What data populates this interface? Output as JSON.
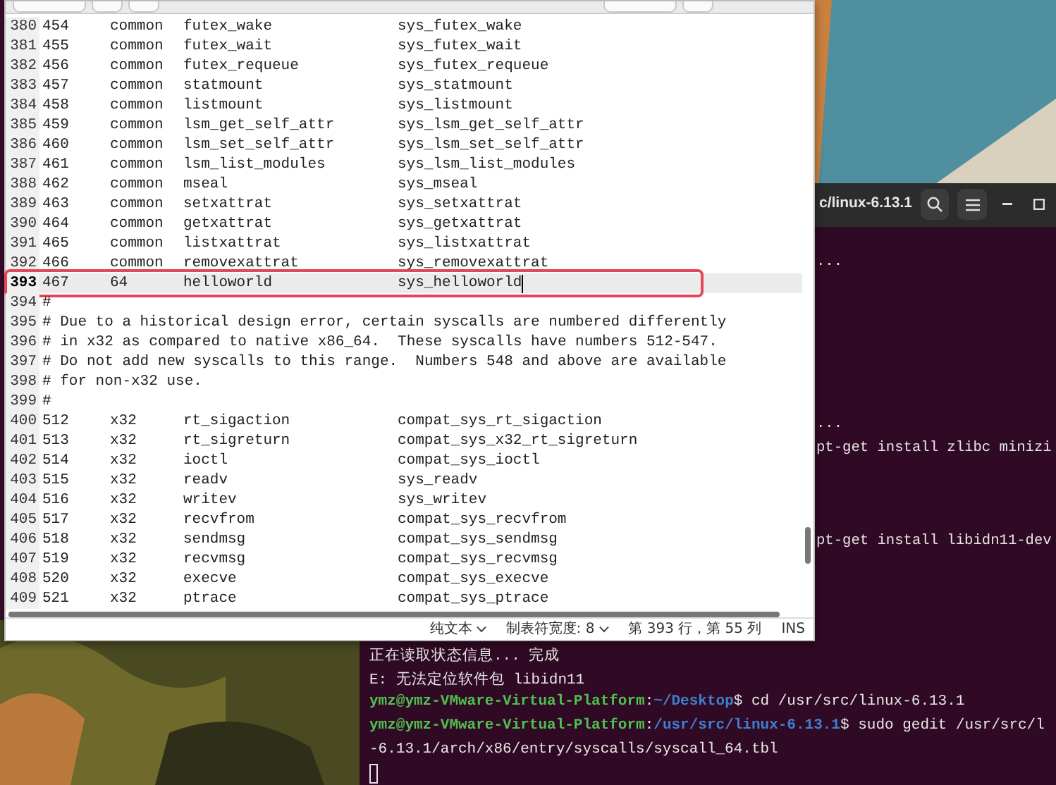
{
  "editor": {
    "lines": [
      {
        "number": "380",
        "kind": "entry",
        "cells": [
          "454",
          "common",
          "futex_wake",
          "sys_futex_wake"
        ],
        "current": false,
        "marked": false
      },
      {
        "number": "381",
        "kind": "entry",
        "cells": [
          "455",
          "common",
          "futex_wait",
          "sys_futex_wait"
        ],
        "current": false,
        "marked": false
      },
      {
        "number": "382",
        "kind": "entry",
        "cells": [
          "456",
          "common",
          "futex_requeue",
          "sys_futex_requeue"
        ],
        "current": false,
        "marked": false
      },
      {
        "number": "383",
        "kind": "entry",
        "cells": [
          "457",
          "common",
          "statmount",
          "sys_statmount"
        ],
        "current": false,
        "marked": false
      },
      {
        "number": "384",
        "kind": "entry",
        "cells": [
          "458",
          "common",
          "listmount",
          "sys_listmount"
        ],
        "current": false,
        "marked": false
      },
      {
        "number": "385",
        "kind": "entry",
        "cells": [
          "459",
          "common",
          "lsm_get_self_attr",
          "sys_lsm_get_self_attr"
        ],
        "current": false,
        "marked": false
      },
      {
        "number": "386",
        "kind": "entry",
        "cells": [
          "460",
          "common",
          "lsm_set_self_attr",
          "sys_lsm_set_self_attr"
        ],
        "current": false,
        "marked": false
      },
      {
        "number": "387",
        "kind": "entry",
        "cells": [
          "461",
          "common",
          "lsm_list_modules",
          "sys_lsm_list_modules"
        ],
        "current": false,
        "marked": false
      },
      {
        "number": "388",
        "kind": "entry",
        "cells": [
          "462",
          "common",
          "mseal",
          "sys_mseal"
        ],
        "current": false,
        "marked": false
      },
      {
        "number": "389",
        "kind": "entry",
        "cells": [
          "463",
          "common",
          "setxattrat",
          "sys_setxattrat"
        ],
        "current": false,
        "marked": false
      },
      {
        "number": "390",
        "kind": "entry",
        "cells": [
          "464",
          "common",
          "getxattrat",
          "sys_getxattrat"
        ],
        "current": false,
        "marked": false
      },
      {
        "number": "391",
        "kind": "entry",
        "cells": [
          "465",
          "common",
          "listxattrat",
          "sys_listxattrat"
        ],
        "current": false,
        "marked": false
      },
      {
        "number": "392",
        "kind": "entry",
        "cells": [
          "466",
          "common",
          "removexattrat",
          "sys_removexattrat"
        ],
        "current": false,
        "marked": false
      },
      {
        "number": "393",
        "kind": "entry",
        "cells": [
          "467",
          "64",
          "helloworld",
          "sys_helloworld"
        ],
        "current": true,
        "marked": true
      },
      {
        "number": "394",
        "kind": "comment",
        "text": "#",
        "current": false,
        "marked": false
      },
      {
        "number": "395",
        "kind": "comment",
        "text": "# Due to a historical design error, certain syscalls are numbered differently",
        "current": false,
        "marked": false
      },
      {
        "number": "396",
        "kind": "comment",
        "text": "# in x32 as compared to native x86_64.  These syscalls have numbers 512-547.",
        "current": false,
        "marked": false
      },
      {
        "number": "397",
        "kind": "comment",
        "text": "# Do not add new syscalls to this range.  Numbers 548 and above are available",
        "current": false,
        "marked": false
      },
      {
        "number": "398",
        "kind": "comment",
        "text": "# for non-x32 use.",
        "current": false,
        "marked": false
      },
      {
        "number": "399",
        "kind": "comment",
        "text": "#",
        "current": false,
        "marked": false
      },
      {
        "number": "400",
        "kind": "entry",
        "cells": [
          "512",
          "x32",
          "rt_sigaction",
          "compat_sys_rt_sigaction"
        ],
        "current": false,
        "marked": false
      },
      {
        "number": "401",
        "kind": "entry",
        "cells": [
          "513",
          "x32",
          "rt_sigreturn",
          "compat_sys_x32_rt_sigreturn"
        ],
        "current": false,
        "marked": false
      },
      {
        "number": "402",
        "kind": "entry",
        "cells": [
          "514",
          "x32",
          "ioctl",
          "compat_sys_ioctl"
        ],
        "current": false,
        "marked": false
      },
      {
        "number": "403",
        "kind": "entry",
        "cells": [
          "515",
          "x32",
          "readv",
          "sys_readv"
        ],
        "current": false,
        "marked": false
      },
      {
        "number": "404",
        "kind": "entry",
        "cells": [
          "516",
          "x32",
          "writev",
          "sys_writev"
        ],
        "current": false,
        "marked": false
      },
      {
        "number": "405",
        "kind": "entry",
        "cells": [
          "517",
          "x32",
          "recvfrom",
          "compat_sys_recvfrom"
        ],
        "current": false,
        "marked": false
      },
      {
        "number": "406",
        "kind": "entry",
        "cells": [
          "518",
          "x32",
          "sendmsg",
          "compat_sys_sendmsg"
        ],
        "current": false,
        "marked": false
      },
      {
        "number": "407",
        "kind": "entry",
        "cells": [
          "519",
          "x32",
          "recvmsg",
          "compat_sys_recvmsg"
        ],
        "current": false,
        "marked": false
      },
      {
        "number": "408",
        "kind": "entry",
        "cells": [
          "520",
          "x32",
          "execve",
          "compat_sys_execve"
        ],
        "current": false,
        "marked": false
      },
      {
        "number": "409",
        "kind": "entry",
        "cells": [
          "521",
          "x32",
          "ptrace",
          "compat_sys_ptrace"
        ],
        "current": false,
        "marked": false
      }
    ],
    "status_bar": [
      {
        "kind": "dropdown",
        "label": "纯文本"
      },
      {
        "kind": "dropdown",
        "label": "制表符宽度: 8"
      },
      {
        "kind": "text",
        "label": "第 393 行，第 55 列"
      },
      {
        "kind": "text",
        "label": "INS"
      }
    ]
  },
  "terminal": {
    "title": "c/linux-6.13.1",
    "lines": [
      {
        "kind": "tail",
        "text": "..."
      },
      {
        "kind": "tail",
        "text": "..."
      },
      {
        "kind": "tail",
        "text": "pt-get install zlibc minizi"
      },
      {
        "kind": "tail",
        "text": "pt-get install libidn11-dev"
      },
      {
        "kind": "output",
        "text": "正在读取状态信息... 完成"
      },
      {
        "kind": "output",
        "text": "E: 无法定位软件包 libidn11"
      },
      {
        "kind": "prompt",
        "user": "ymz@ymz-VMware-Virtual-Platform",
        "separator": ":",
        "path": "~/Desktop",
        "command": "$ cd /usr/src/linux-6.13.1"
      },
      {
        "kind": "prompt",
        "user": "ymz@ymz-VMware-Virtual-Platform",
        "separator": ":",
        "path": "/usr/src/linux-6.13.1",
        "command": "$ sudo gedit /usr/src/l"
      },
      {
        "kind": "output",
        "text": "-6.13.1/arch/x86/entry/syscalls/syscall_64.tbl"
      },
      {
        "kind": "cursor"
      }
    ]
  }
}
